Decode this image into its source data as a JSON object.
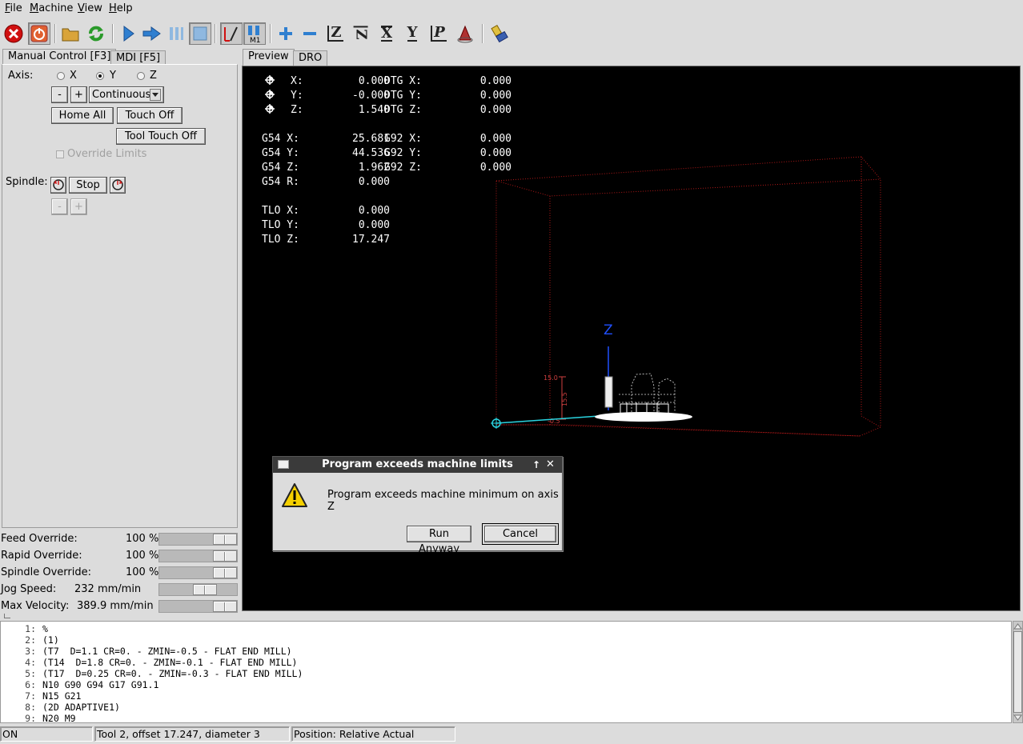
{
  "menubar": [
    "File",
    "Machine",
    "View",
    "Help"
  ],
  "toolbar": {
    "icons": [
      "estop-icon",
      "machine-power-icon",
      "open-file-icon",
      "reload-icon",
      "run-icon",
      "step-icon",
      "pause-icon",
      "stop-icon",
      "optional-block-skip-icon",
      "optional-stop-icon",
      "zoom-in-icon",
      "zoom-out-icon",
      "view-z-icon",
      "view-z-rotated-icon",
      "view-x-icon",
      "view-y-icon",
      "view-p-icon",
      "rotate-view-icon",
      "clear-plot-icon"
    ],
    "view_letters": {
      "z": "Z",
      "zr": "Z",
      "x": "X",
      "y": "Y",
      "p": "P"
    }
  },
  "left_tabs": [
    "Manual Control [F3]",
    "MDI [F5]"
  ],
  "manual": {
    "axis_label": "Axis:",
    "axes": [
      {
        "label": "X",
        "selected": false
      },
      {
        "label": "Y",
        "selected": true
      },
      {
        "label": "Z",
        "selected": false
      }
    ],
    "jog_minus": "-",
    "jog_plus": "+",
    "jog_mode": "Continuous",
    "home_all": "Home All",
    "touch_off": "Touch Off",
    "tool_touch_off": "Tool Touch Off",
    "override_limits": "Override Limits",
    "spindle_label": "Spindle:",
    "spindle_stop": "Stop",
    "spindle_minus": "-",
    "spindle_plus": "+"
  },
  "sliders": [
    {
      "label": "Feed Override:",
      "value": "100 %",
      "level": 1.0
    },
    {
      "label": "Rapid Override:",
      "value": "100 %",
      "level": 1.0
    },
    {
      "label": "Spindle Override:",
      "value": "100 %",
      "level": 1.0
    },
    {
      "label": "Jog Speed:",
      "value": "232 mm/min",
      "level": 0.62
    },
    {
      "label": "Max Velocity:",
      "value": "389.9 mm/min",
      "level": 1.0
    }
  ],
  "right_tabs": [
    "Preview",
    "DRO"
  ],
  "dro": {
    "rows": [
      [
        "X:",
        "0.000",
        "DTG X:",
        "0.000"
      ],
      [
        "Y:",
        "-0.000",
        "DTG Y:",
        "0.000"
      ],
      [
        "Z:",
        "1.540",
        "DTG Z:",
        "0.000"
      ]
    ],
    "g54": [
      [
        "G54 X:",
        "25.681",
        "G92 X:",
        "0.000"
      ],
      [
        "G54 Y:",
        "44.536",
        "G92 Y:",
        "0.000"
      ],
      [
        "G54 Z:",
        "1.962",
        "G92 Z:",
        "0.000"
      ],
      [
        "G54 R:",
        "0.000",
        "",
        ""
      ]
    ],
    "tlo": [
      [
        "TLO X:",
        "0.000"
      ],
      [
        "TLO Y:",
        "0.000"
      ],
      [
        "TLO Z:",
        "17.247"
      ]
    ]
  },
  "preview_labels": {
    "z_axis": "Z",
    "dim1": "15.0",
    "dim2": "15.5",
    "dim3": "-0.5"
  },
  "dialog": {
    "title": "Program exceeds machine limits",
    "message": "Program exceeds machine minimum on axis Z",
    "run_anyway": "Run Anyway",
    "cancel": "Cancel",
    "title_buttons": [
      "↑",
      "✕"
    ]
  },
  "code_lines": [
    {
      "n": "1:",
      "text": "%"
    },
    {
      "n": "2:",
      "text": "(1)"
    },
    {
      "n": "3:",
      "text": "(T7  D=1.1 CR=0. - ZMIN=-0.5 - FLAT END MILL)"
    },
    {
      "n": "4:",
      "text": "(T14  D=1.8 CR=0. - ZMIN=-0.1 - FLAT END MILL)"
    },
    {
      "n": "5:",
      "text": "(T17  D=0.25 CR=0. - ZMIN=-0.3 - FLAT END MILL)"
    },
    {
      "n": "6:",
      "text": "N10 G90 G94 G17 G91.1"
    },
    {
      "n": "7:",
      "text": "N15 G21"
    },
    {
      "n": "8:",
      "text": "(2D ADAPTIVE1)"
    },
    {
      "n": "9:",
      "text": "N20 M9"
    }
  ],
  "status": {
    "state": "ON",
    "tool": "Tool 2, offset 17.247, diameter 3",
    "position": "Position: Relative Actual"
  }
}
